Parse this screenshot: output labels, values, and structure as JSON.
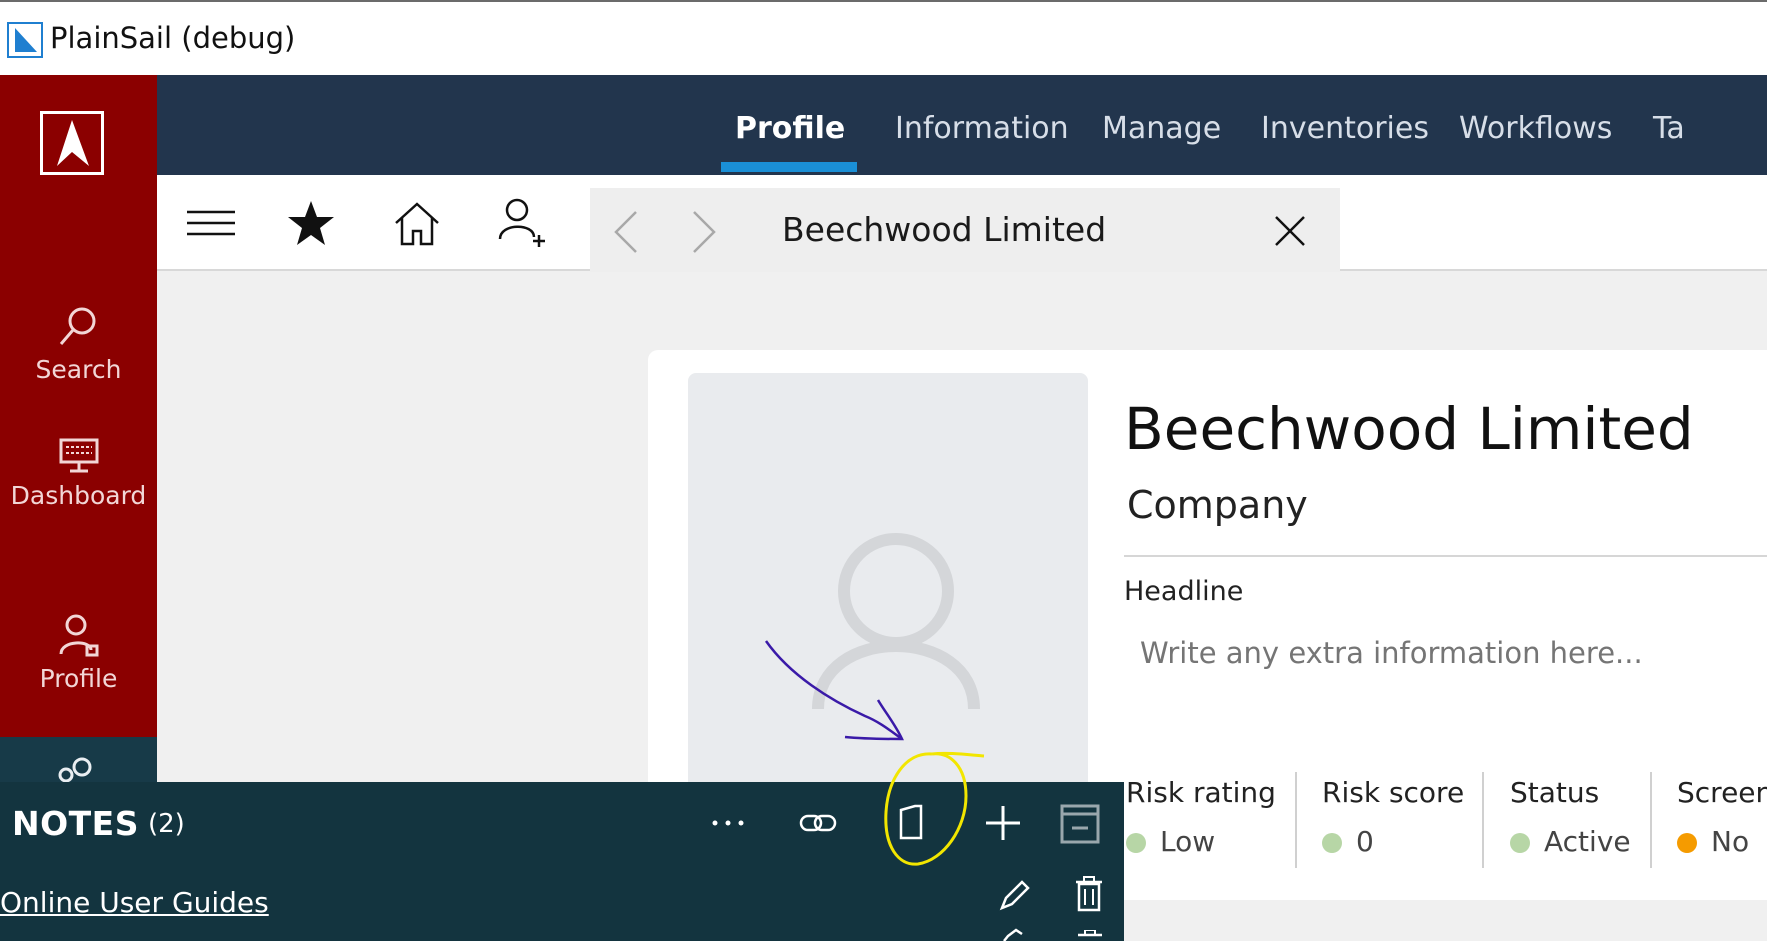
{
  "window": {
    "title": "PlainSail (debug)"
  },
  "rail": {
    "items": [
      {
        "label": "Search",
        "icon": "search-icon"
      },
      {
        "label": "Dashboard",
        "icon": "monitor-icon"
      },
      {
        "label": "Profile",
        "icon": "person-icon"
      },
      {
        "label": "",
        "icon": "people-icon"
      }
    ]
  },
  "nav": {
    "tabs": [
      {
        "label": "Profile",
        "active": true
      },
      {
        "label": "Information"
      },
      {
        "label": "Manage"
      },
      {
        "label": "Inventories"
      },
      {
        "label": "Workflows"
      },
      {
        "label": "Ta"
      }
    ]
  },
  "toolbar": {
    "icons": [
      "menu-icon",
      "star-icon",
      "home-icon",
      "add-person-icon"
    ],
    "crumb": {
      "title": "Beechwood Limited",
      "icons": [
        "back-icon",
        "forward-icon",
        "close-icon"
      ]
    }
  },
  "profile": {
    "name": "Beechwood Limited",
    "type": "Company",
    "headline_label": "Headline",
    "headline_placeholder": "Write any extra information here...",
    "metrics": [
      {
        "label": "Risk rating",
        "value": "Low",
        "color": "#b7d6a6"
      },
      {
        "label": "Risk score",
        "value": "0",
        "color": "#b7d6a6"
      },
      {
        "label": "Status",
        "value": "Active",
        "color": "#b7d6a6"
      },
      {
        "label": "Screen",
        "value": "No",
        "color": "#f59b00"
      }
    ]
  },
  "notes": {
    "title": "NOTES",
    "count": "(2)",
    "items": [
      {
        "label": "Online User Guides"
      }
    ],
    "actions": [
      "more-icon",
      "link-icon",
      "page-icon",
      "add-icon",
      "minimize-icon"
    ]
  },
  "colors": {
    "rail": "#8b0000",
    "nav": "#22354d",
    "accent": "#1a8fd6",
    "notes": "#13343f",
    "annotation_pen": "#3a1aa8",
    "annotation_highlight": "#f2e600"
  }
}
